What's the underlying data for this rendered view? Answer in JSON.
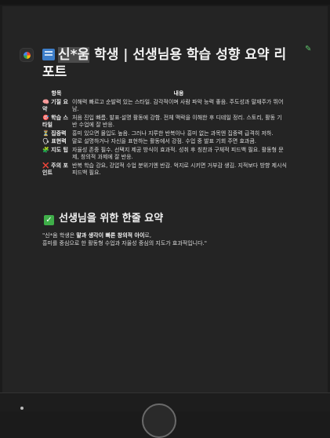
{
  "title": {
    "name_highlighted": "신*움",
    "rest": " 학생 | 선생님용 학습 성향 요약 리포트"
  },
  "table": {
    "headers": [
      "항목",
      "내용"
    ],
    "rows": [
      {
        "icon": "🧠",
        "label": "기질 요약",
        "desc": "이해력 빠르고 순발력 있는 스타일. 감각적이며 사람 파악 능력 좋음. 주도성과 말재주가 뛰어남."
      },
      {
        "icon": "🎯",
        "label": "학습 스타일",
        "desc": "처음 진입 빠름. 발표·설명 활동에 강함. 전체 맥락을 이해한 후 디테일 정리. 스토리, 활동 기반 수업에 잘 반응."
      },
      {
        "icon": "⏳",
        "label": "집중력",
        "desc": "흥미 있으면 몰입도 높음. 그러나 지루한 반복이나 흥미 없는 과목엔 집중력 급격히 저하."
      },
      {
        "icon": "🗣",
        "label": "표현력",
        "desc": "말로 설명하거나 자신을 표현하는 활동에서 강점. 수업 중 발표 기회 주면 효과큼."
      },
      {
        "icon": "🧩",
        "label": "지도 팁",
        "desc": "자율성 존중 필수. 선택지 제공 방식이 효과적. 성취 후 칭찬과 구체적 피드백 필요. 활동형 문제, 창의적 과제에 잘 반응."
      },
      {
        "icon": "❌",
        "label": "주의 포인트",
        "desc": "반복 학습 강요, 강압적 수업 분위기엔 반감. 억지로 시키면 거부감 생김. 지적보다 방향 제시식 피드백 필요."
      }
    ]
  },
  "summary": {
    "heading": "선생님을 위한 한줄 요약",
    "quote_open": "\"신*움 학생은 ",
    "quote_bold": "말과 생각이 빠른 창의적 아이",
    "quote_after": "로,",
    "quote_line2": " 흥미를 중심으로 한 활동형 수업과 자율성 중심의 지도가 효과적입니다.\""
  },
  "colors": {
    "background": "#1b1b1b",
    "panel": "#242424",
    "accent_green": "#3fae49"
  }
}
